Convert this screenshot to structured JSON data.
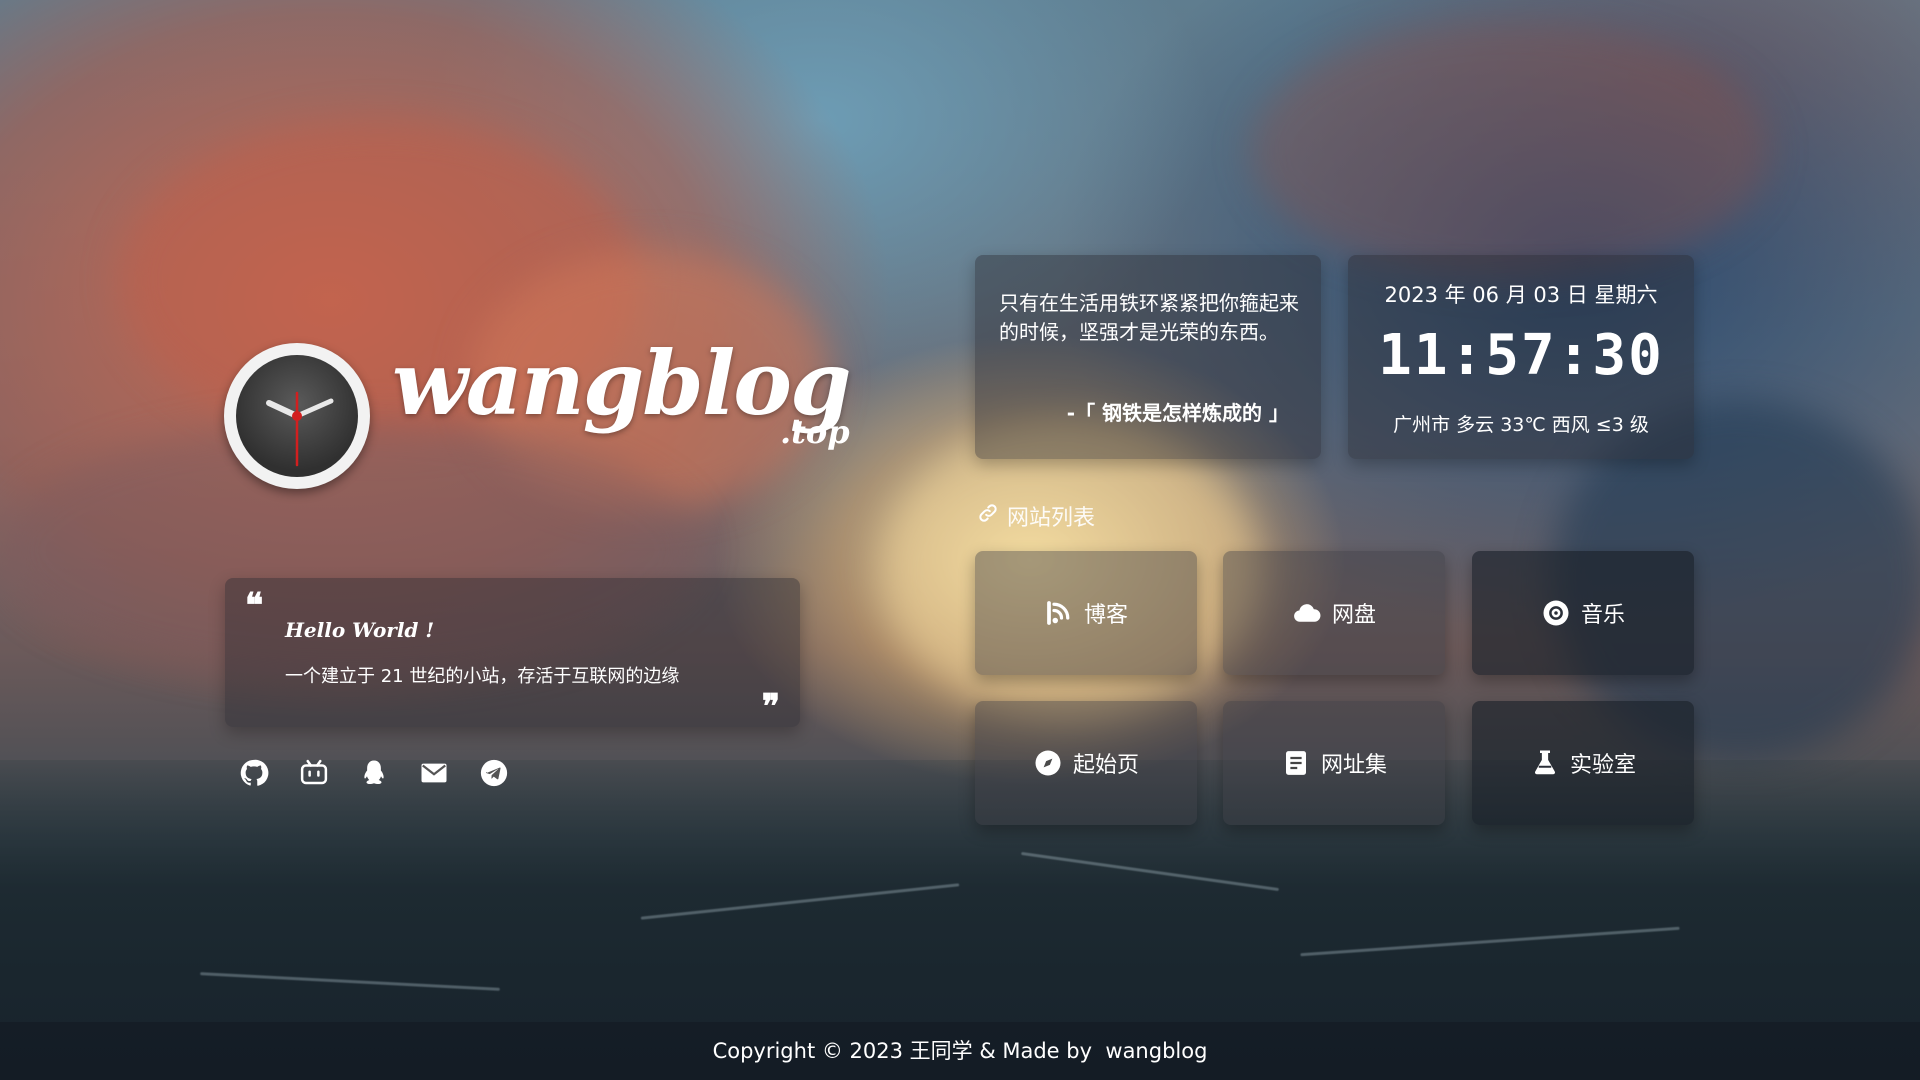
{
  "logo": {
    "text": "wangblog",
    "suffix": ".top"
  },
  "hello": {
    "heading": "Hello World !",
    "desc": "一个建立于 21 世纪的小站，存活于互联网的边缘"
  },
  "social": [
    "github-icon",
    "bilibili-icon",
    "qq-icon",
    "mail-icon",
    "telegram-icon"
  ],
  "quote": {
    "text": "只有在生活用铁环紧紧把你箍起来的时候，坚强才是光荣的东西。",
    "source": "-「 钢铁是怎样炼成的 」"
  },
  "time": {
    "date": "2023 年 06 月 03 日 星期六",
    "clock": "11:57:30",
    "weather": "广州市 多云 33℃ 西风 ≤3 级"
  },
  "sites": {
    "title": "网站列表",
    "items": [
      {
        "label": "博客",
        "icon": "rss-icon"
      },
      {
        "label": "网盘",
        "icon": "cloud-icon"
      },
      {
        "label": "音乐",
        "icon": "disc-icon"
      },
      {
        "label": "起始页",
        "icon": "compass-icon"
      },
      {
        "label": "网址集",
        "icon": "book-icon"
      },
      {
        "label": "实验室",
        "icon": "flask-icon"
      }
    ]
  },
  "footer": {
    "text": "Copyright © 2023 王同学 & Made by  wangblog"
  }
}
